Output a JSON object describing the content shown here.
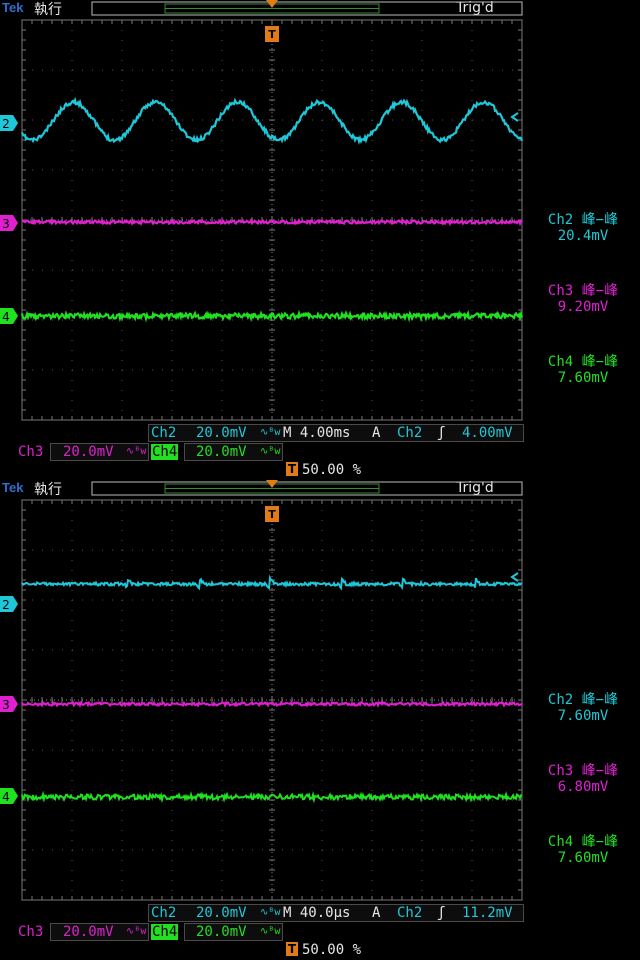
{
  "colors": {
    "ch2": "#1ec8d8",
    "ch3": "#e020d0",
    "ch4": "#20e020",
    "trigger": "#e07b16",
    "grid": "#555555"
  },
  "screens": [
    {
      "brand": "Tek",
      "run_state": "執行",
      "trig_state": "Trig'd",
      "markers": {
        "ch2": "2",
        "ch3": "3",
        "ch4": "4",
        "trigger": "T"
      },
      "measurements": [
        {
          "label": "Ch2 峰−峰",
          "value": "20.4mV"
        },
        {
          "label": "Ch3 峰−峰",
          "value": "9.20mV"
        },
        {
          "label": "Ch4 峰−峰",
          "value": "7.60mV"
        }
      ],
      "status": {
        "ch2_name": "Ch2",
        "ch2_scale": "20.0mV",
        "bw_symbol": "∿ᴮw",
        "timebase": "M 4.00ms",
        "trig_mode": "A",
        "trig_source": "Ch2",
        "trig_slope": "ʃ",
        "trig_level": "4.00mV",
        "ch3_name": "Ch3",
        "ch3_scale": "20.0mV",
        "ch4_name": "Ch4",
        "ch4_scale": "20.0mV",
        "trig_position": "50.00 %"
      }
    },
    {
      "brand": "Tek",
      "run_state": "執行",
      "trig_state": "Trig'd",
      "markers": {
        "ch2": "2",
        "ch3": "3",
        "ch4": "4",
        "trigger": "T"
      },
      "measurements": [
        {
          "label": "Ch2 峰−峰",
          "value": "7.60mV"
        },
        {
          "label": "Ch3 峰−峰",
          "value": "6.80mV"
        },
        {
          "label": "Ch4 峰−峰",
          "value": "7.60mV"
        }
      ],
      "status": {
        "ch2_name": "Ch2",
        "ch2_scale": "20.0mV",
        "bw_symbol": "∿ᴮw",
        "timebase": "M 40.0µs",
        "trig_mode": "A",
        "trig_source": "Ch2",
        "trig_slope": "ʃ",
        "trig_level": "11.2mV",
        "ch3_name": "Ch3",
        "ch3_scale": "20.0mV",
        "ch4_name": "Ch4",
        "ch4_scale": "20.0mV",
        "trig_position": "50.00 %"
      }
    }
  ]
}
